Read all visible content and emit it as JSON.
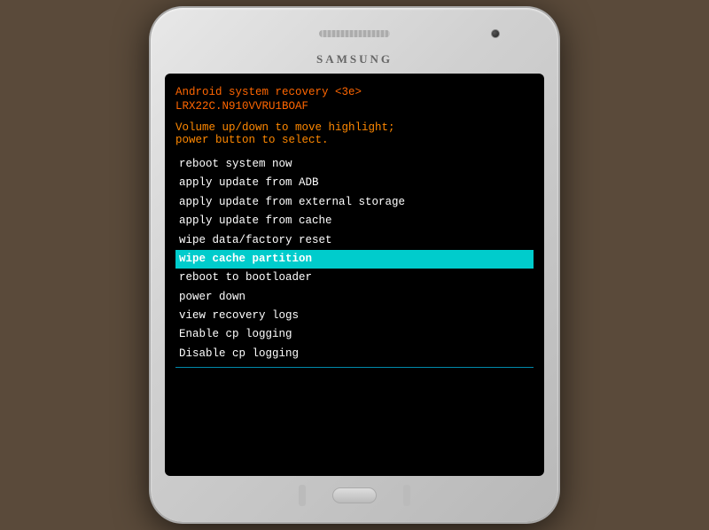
{
  "phone": {
    "brand": "SAMSUNG",
    "speaker_label": "speaker",
    "camera_label": "camera"
  },
  "screen": {
    "header_line1": "Android system recovery <3e>",
    "header_line2": "LRX22C.N910VVRU1BOAF",
    "instruction_line1": "Volume up/down to move highlight;",
    "instruction_line2": "power button to select.",
    "menu_items": [
      {
        "label": "reboot system now",
        "highlighted": false
      },
      {
        "label": "apply update from ADB",
        "highlighted": false
      },
      {
        "label": "apply update from external storage",
        "highlighted": false
      },
      {
        "label": "apply update from cache",
        "highlighted": false
      },
      {
        "label": "wipe data/factory reset",
        "highlighted": false
      },
      {
        "label": "wipe cache partition",
        "highlighted": true
      },
      {
        "label": "reboot to bootloader",
        "highlighted": false
      },
      {
        "label": "power down",
        "highlighted": false
      },
      {
        "label": "view recovery logs",
        "highlighted": false
      },
      {
        "label": "Enable cp logging",
        "highlighted": false
      },
      {
        "label": "Disable cp logging",
        "highlighted": false
      }
    ]
  }
}
